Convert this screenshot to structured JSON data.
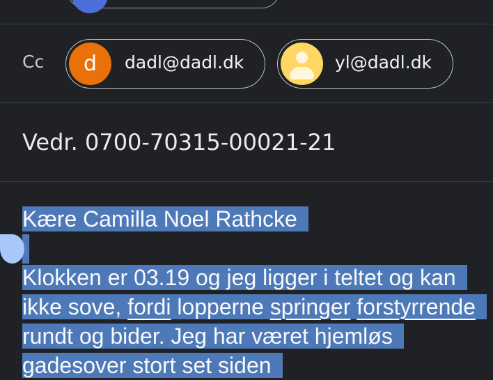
{
  "cc": {
    "label": "Cc",
    "recipients": [
      {
        "initial": "d",
        "email": "dadl@dadl.dk",
        "avatar_color": "#e8710a"
      },
      {
        "initial": "",
        "email": "yl@dadl.dk",
        "avatar_color": "#fdd663"
      }
    ]
  },
  "subject": "Vedr. 0700-70315-00021-21",
  "body": {
    "greeting": "Kære Camilla Noel Rathcke",
    "paragraph": {
      "part1": "Klokken er 03.19 og jeg ligger i teltet og kan ikke sove, ",
      "word_fordi": "fordi",
      "part2": " lopperne ",
      "word_springer": "springer",
      "part3": " ",
      "word_forstyrrende": "forstyrrende",
      "part4": " rundt og bider. Jeg har været hjemløs gadesover stort set siden"
    }
  },
  "colors": {
    "background": "#1f2124",
    "selection": "#4e79b8",
    "handle": "#a8c7fa"
  }
}
